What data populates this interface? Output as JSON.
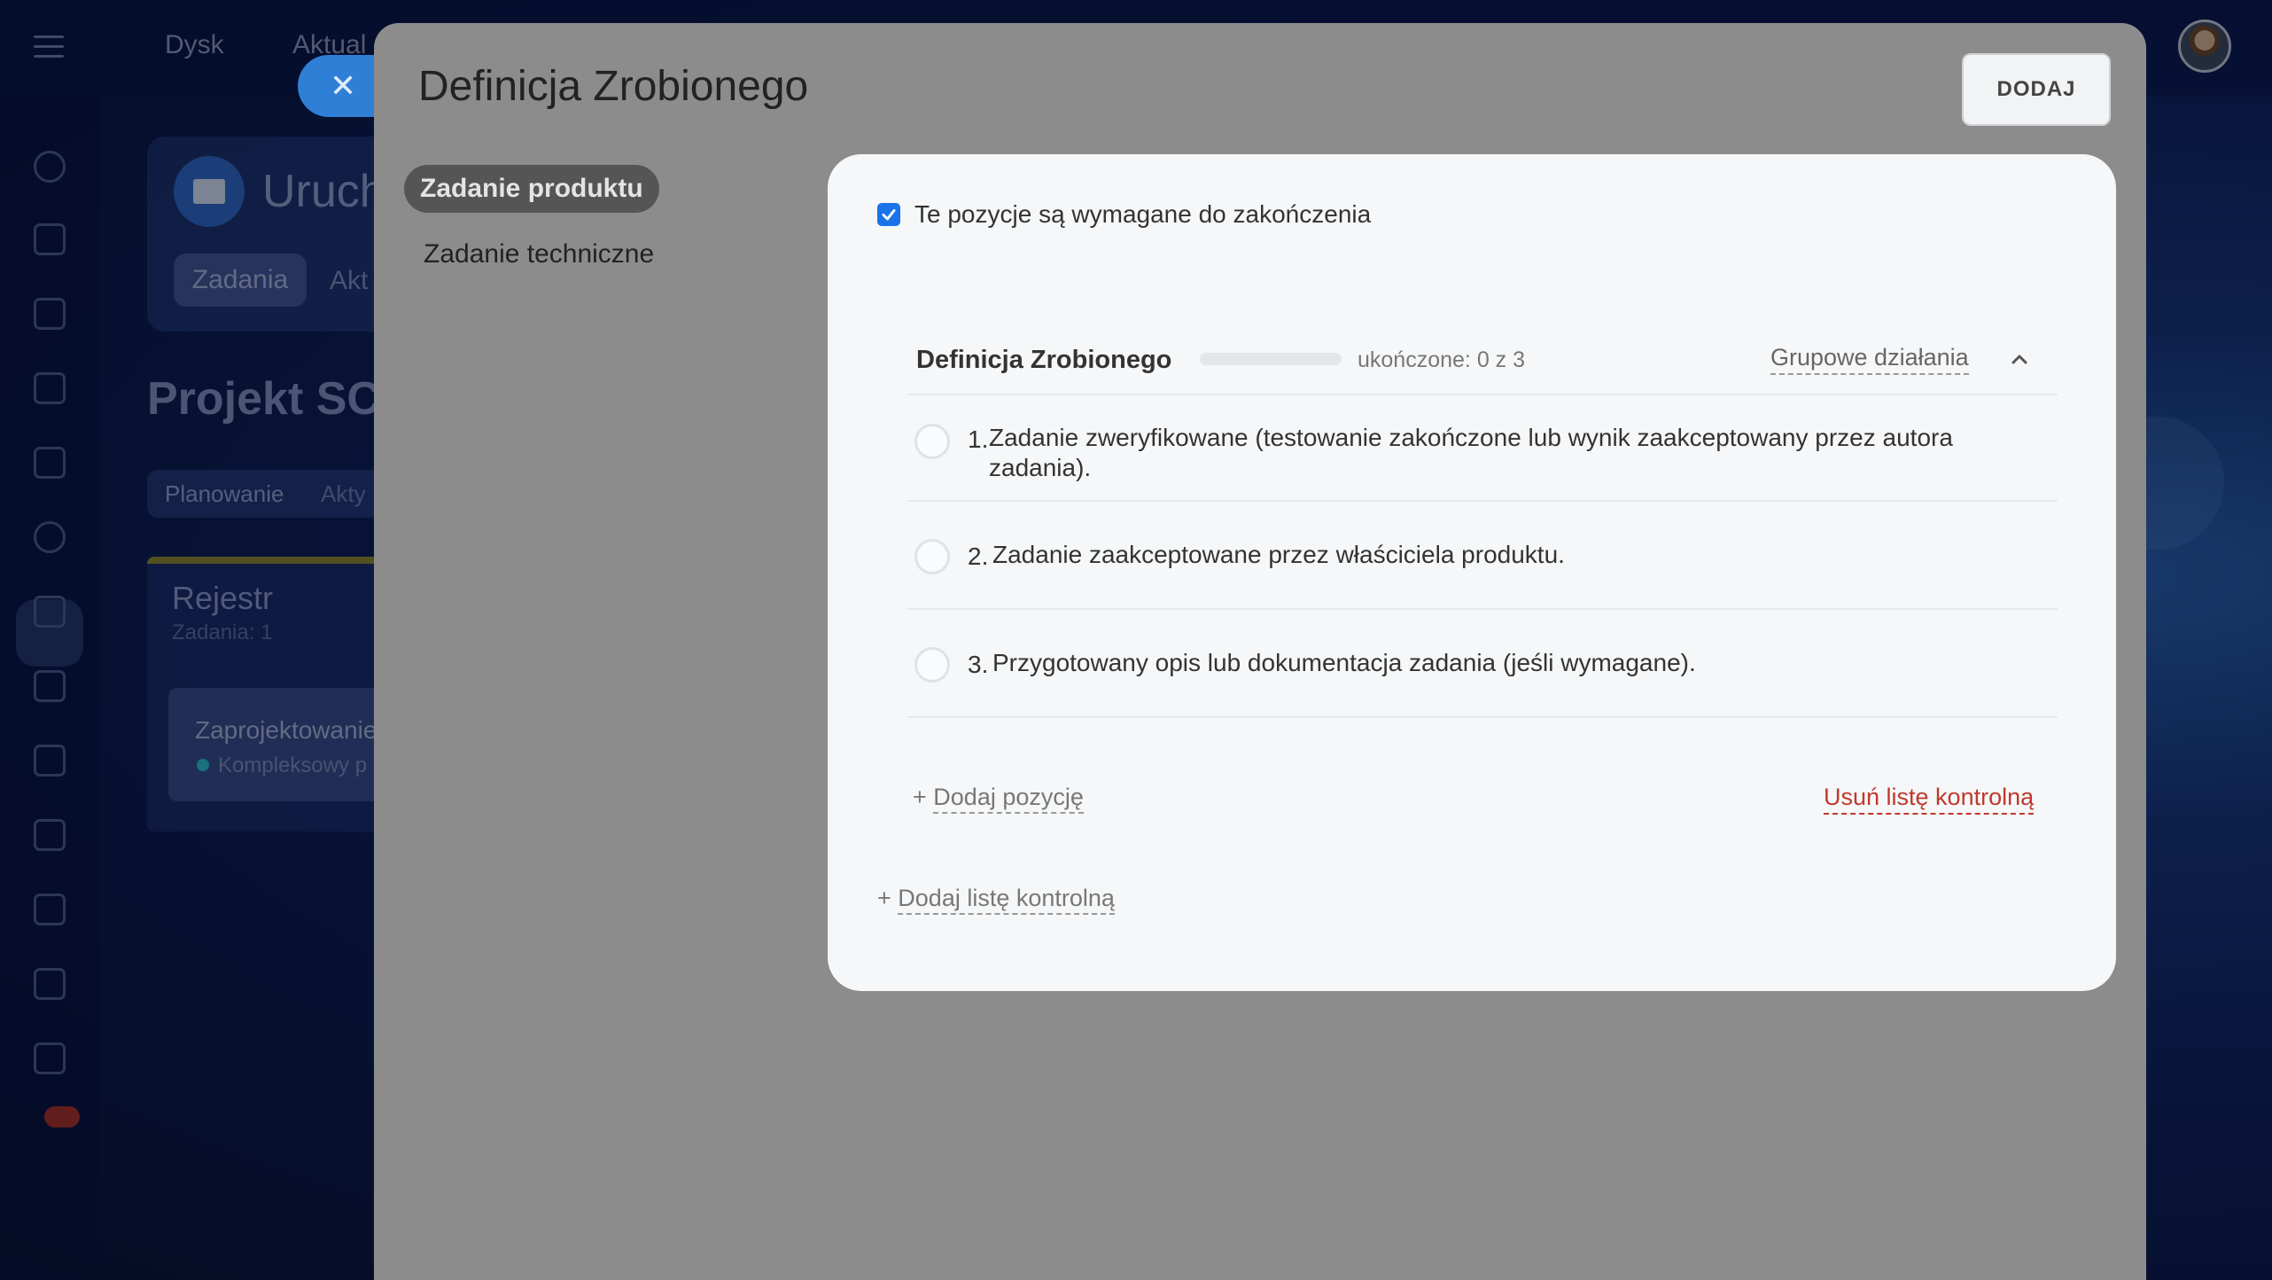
{
  "background": {
    "nav": {
      "disk": "Dysk",
      "news": "Aktual"
    },
    "project_card_title": "Uruch",
    "project_tabs": [
      "Zadania",
      "Akt"
    ],
    "project_title": "Projekt SCR",
    "filters": [
      "Planowanie",
      "Akty"
    ],
    "column": {
      "title": "Rejestr",
      "subtitle": "Zadania: 1"
    },
    "task": {
      "title": "Zaprojektowanie",
      "subtitle": "Kompleksowy p"
    }
  },
  "slider": {
    "close_icon": "close-icon",
    "title": "Definicja Zrobionego",
    "add_button": "DODAJ",
    "tabs": [
      {
        "label": "Zadanie produktu",
        "active": true
      },
      {
        "label": "Zadanie techniczne",
        "active": false
      }
    ]
  },
  "dialog": {
    "required_checkbox": {
      "checked": true,
      "label": "Te pozycje są wymagane do zakończenia"
    },
    "checklist": {
      "title": "Definicja Zrobionego",
      "completed": 0,
      "total": 3,
      "progress_text": "ukończone: 0 z 3",
      "group_actions": "Grupowe działania",
      "items": [
        {
          "num": "1.",
          "line1": "Zadanie zweryfikowane (testowanie zakończone lub wynik zaakceptowany przez autora",
          "line2": "zadania)."
        },
        {
          "num": "2.",
          "line1": "Zadanie zaakceptowane przez właściciela produktu.",
          "line2": ""
        },
        {
          "num": "3.",
          "line1": "Przygotowany opis lub dokumentacja zadania (jeśli wymagane).",
          "line2": ""
        }
      ],
      "add_item_prefix": "+",
      "add_item": "Dodaj pozycję",
      "remove_list": "Usuń listę kontrolną"
    },
    "add_list_prefix": "+",
    "add_list": "Dodaj listę kontrolną"
  },
  "colors": {
    "accent": "#1a73e8",
    "progress": "#2fc6f6",
    "danger": "#c0392b"
  }
}
